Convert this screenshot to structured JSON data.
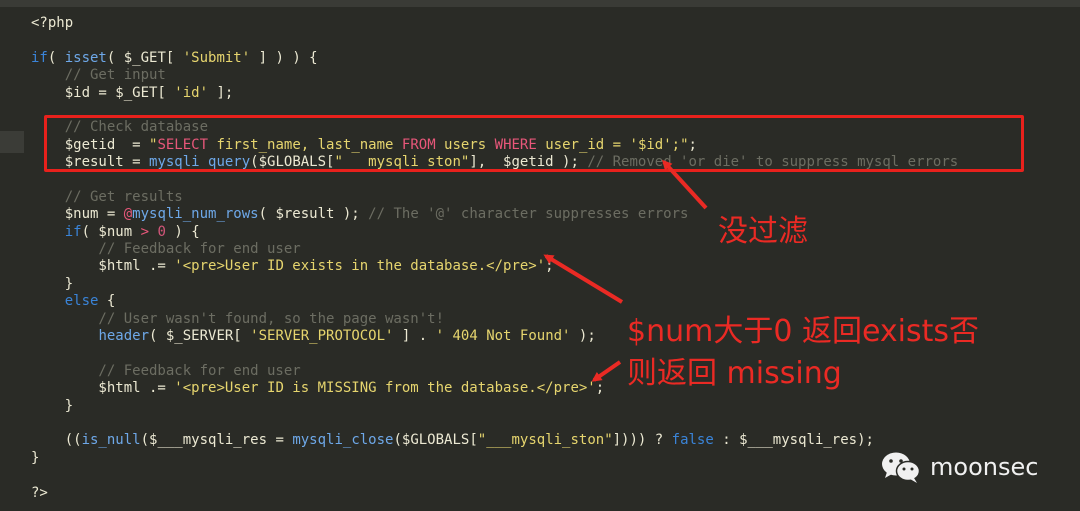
{
  "code_lines": [
    [
      {
        "t": "<?php",
        "c": "var"
      }
    ],
    [],
    [
      {
        "t": "if",
        "c": "kw"
      },
      {
        "t": "( ",
        "c": "var"
      },
      {
        "t": "isset",
        "c": "fn"
      },
      {
        "t": "( $_GET[ ",
        "c": "var"
      },
      {
        "t": "'Submit'",
        "c": "str"
      },
      {
        "t": " ] ) ) {",
        "c": "var"
      }
    ],
    [
      {
        "t": "    // Get input",
        "c": "cm"
      }
    ],
    [
      {
        "t": "    $id = $_GET[ ",
        "c": "var"
      },
      {
        "t": "'id'",
        "c": "str"
      },
      {
        "t": " ];",
        "c": "var"
      }
    ],
    [],
    [
      {
        "t": "    // Check database",
        "c": "cm"
      }
    ],
    [
      {
        "t": "    $getid  = ",
        "c": "var"
      },
      {
        "t": "\"",
        "c": "str"
      },
      {
        "t": "SELECT",
        "c": "sql"
      },
      {
        "t": " first_name, last_name ",
        "c": "str"
      },
      {
        "t": "FROM",
        "c": "sql"
      },
      {
        "t": " users ",
        "c": "str"
      },
      {
        "t": "WHERE",
        "c": "sql"
      },
      {
        "t": " user_id = '$id';\"",
        "c": "str"
      },
      {
        "t": ";",
        "c": "var"
      }
    ],
    [
      {
        "t": "    $result = ",
        "c": "var"
      },
      {
        "t": "mysqli_query",
        "c": "fn"
      },
      {
        "t": "($GLOBALS[",
        "c": "var"
      },
      {
        "t": "\"___mysqli_ston\"",
        "c": "str"
      },
      {
        "t": "],  $getid ); ",
        "c": "var"
      },
      {
        "t": "// Removed 'or die' to suppress mysql errors",
        "c": "cm"
      }
    ],
    [],
    [
      {
        "t": "    // Get results",
        "c": "cm"
      }
    ],
    [
      {
        "t": "    $num = ",
        "c": "var"
      },
      {
        "t": "@",
        "c": "op"
      },
      {
        "t": "mysqli_num_rows",
        "c": "fn"
      },
      {
        "t": "( $result ); ",
        "c": "var"
      },
      {
        "t": "// The '@' character suppresses errors",
        "c": "cm"
      }
    ],
    [
      {
        "t": "    ",
        "c": "var"
      },
      {
        "t": "if",
        "c": "kw"
      },
      {
        "t": "( $num ",
        "c": "var"
      },
      {
        "t": ">",
        "c": "op"
      },
      {
        "t": " ",
        "c": "var"
      },
      {
        "t": "0",
        "c": "num"
      },
      {
        "t": " ) {",
        "c": "var"
      }
    ],
    [
      {
        "t": "        // Feedback for end user",
        "c": "cm"
      }
    ],
    [
      {
        "t": "        $html .= ",
        "c": "var"
      },
      {
        "t": "'<pre>User ID exists in the database.</pre>'",
        "c": "str"
      },
      {
        "t": ";",
        "c": "var"
      }
    ],
    [
      {
        "t": "    }",
        "c": "var"
      }
    ],
    [
      {
        "t": "    ",
        "c": "var"
      },
      {
        "t": "else",
        "c": "kw"
      },
      {
        "t": " {",
        "c": "var"
      }
    ],
    [
      {
        "t": "        // User wasn't found, so the page wasn't!",
        "c": "cm"
      }
    ],
    [
      {
        "t": "        ",
        "c": "var"
      },
      {
        "t": "header",
        "c": "fn"
      },
      {
        "t": "( $_SERVER[ ",
        "c": "var"
      },
      {
        "t": "'SERVER_PROTOCOL'",
        "c": "str"
      },
      {
        "t": " ] . ",
        "c": "var"
      },
      {
        "t": "' 404 Not Found'",
        "c": "str"
      },
      {
        "t": " );",
        "c": "var"
      }
    ],
    [],
    [
      {
        "t": "        // Feedback for end user",
        "c": "cm"
      }
    ],
    [
      {
        "t": "        $html .= ",
        "c": "var"
      },
      {
        "t": "'<pre>User ID is MISSING from the database.</pre>'",
        "c": "str"
      },
      {
        "t": ";",
        "c": "var"
      }
    ],
    [
      {
        "t": "    }",
        "c": "var"
      }
    ],
    [],
    [
      {
        "t": "    ((",
        "c": "var"
      },
      {
        "t": "is_null",
        "c": "fn"
      },
      {
        "t": "($___mysqli_res = ",
        "c": "var"
      },
      {
        "t": "mysqli_close",
        "c": "fn"
      },
      {
        "t": "($GLOBALS[",
        "c": "var"
      },
      {
        "t": "\"___mysqli_ston\"",
        "c": "str"
      },
      {
        "t": "]))) ? ",
        "c": "var"
      },
      {
        "t": "false",
        "c": "kw"
      },
      {
        "t": " : $___mysqli_res);",
        "c": "var"
      }
    ],
    [
      {
        "t": "}",
        "c": "var"
      }
    ],
    [],
    [
      {
        "t": "?>",
        "c": "var"
      }
    ]
  ],
  "annotations": {
    "no_filter": "没过滤",
    "num_line1": "$num大于0 返回exists否",
    "num_line2": "则返回 missing"
  },
  "watermark": {
    "icon": "wechat-icon",
    "text": "moonsec"
  },
  "colors": {
    "annotation_red": "#ea2a24",
    "background": "#2a2b26"
  }
}
